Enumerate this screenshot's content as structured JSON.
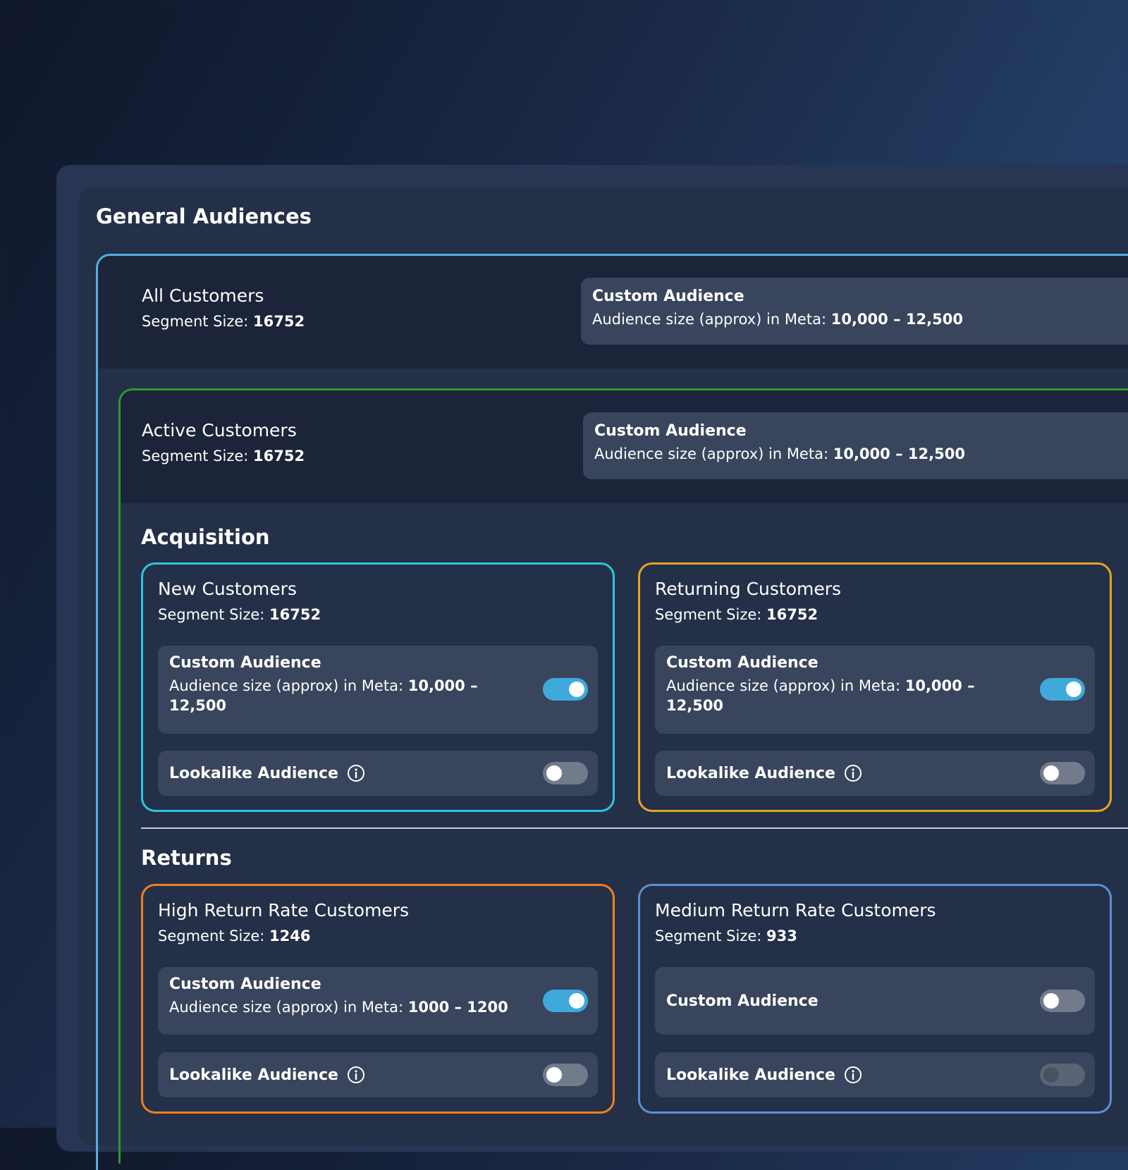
{
  "page": {
    "title": "General Audiences"
  },
  "labels": {
    "segment_size": "Segment Size:",
    "custom_audience": "Custom Audience",
    "audience_size_prefix": "Audience size (approx) in Meta:",
    "lookalike_audience": "Lookalike Audience"
  },
  "all_customers": {
    "name": "All Customers",
    "segment_size": "16752",
    "meta_size": "10,000 – 12,500"
  },
  "active_customers": {
    "name": "Active Customers",
    "segment_size": "16752",
    "meta_size": "10,000 – 12,500"
  },
  "sections": {
    "acquisition": "Acquisition",
    "returns": "Returns"
  },
  "cards": {
    "new_customers": {
      "name": "New Customers",
      "segment_size": "16752",
      "meta_size": "10,000 – 12,500",
      "custom_on": true,
      "lookalike_on": false,
      "border": "#2ec4dc"
    },
    "returning_customers": {
      "name": "Returning Customers",
      "segment_size": "16752",
      "meta_size": "10,000 – 12,500",
      "custom_on": true,
      "lookalike_on": false,
      "border": "#e6a520"
    },
    "high_return": {
      "name": "High Return Rate Customers",
      "segment_size": "1246",
      "meta_size": "1000 – 1200",
      "custom_on": true,
      "lookalike_on": false,
      "border": "#f07f20"
    },
    "medium_return": {
      "name": "Medium Return Rate Customers",
      "segment_size": "933",
      "custom_on": false,
      "lookalike_on": false,
      "lookalike_disabled": true,
      "border": "#5d8fd6"
    }
  },
  "icons": {
    "info": "info-circle-icon"
  }
}
